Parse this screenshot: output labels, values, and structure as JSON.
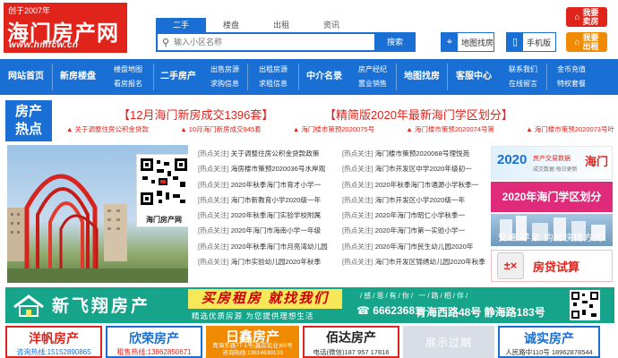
{
  "logo": {
    "since": "创于2007年",
    "name": "海门房产网",
    "url": "www.hmfcw.cn"
  },
  "search": {
    "tabs": [
      "二手",
      "楼盘",
      "出租",
      "资讯"
    ],
    "active_tab": "二手",
    "placeholder": "输入小区名称",
    "button": "搜索"
  },
  "header_buttons": {
    "map": "地图找房",
    "phone": "手机版",
    "sell_line1": "我要",
    "sell_line2": "卖房",
    "rent_line1": "我要",
    "rent_line2": "出租"
  },
  "nav": {
    "home": "网站首页",
    "new_homes": "新房楼盘",
    "new_sub_1": "楼盘地图",
    "new_sub_2": "看房报名",
    "second_hand": "二手房产",
    "sh_sub_1": "出售房源",
    "sh_sub_2": "求购信息",
    "rent_sub_1": "出租房源",
    "rent_sub_2": "求租信息",
    "agency": "中介名录",
    "agency_sub_1": "房产经纪",
    "agency_sub_2": "置业销售",
    "map_search": "地图找房",
    "customer": "客服中心",
    "cs_sub_1": "联系我们",
    "cs_sub_2": "在线留言",
    "vip_sub_1": "金币充值",
    "vip_sub_2": "特权套餐"
  },
  "hot": {
    "label_1": "房产",
    "label_2": "热点",
    "headline_1": "【12月海门新房成交1396套】",
    "headline_2": "【精简版2020年最新海门学区划分】",
    "sublinks": [
      "▲ 关于调整住房公积金贷款",
      "▲ 10月海门新房成交945套",
      "▲ 海门楼市第预2020075号",
      "▲ 海门楼市策预2020074号第",
      "▲ 海门楼市策预2020073号叶"
    ]
  },
  "photo": {
    "qr_caption": "海门房产网"
  },
  "hot_links": {
    "tag": "[热点关注]",
    "rows": [
      [
        "关于调整住房公积金贷款政策",
        "海门楼市策预2020068号理悦苑"
      ],
      [
        "海房楼市策预2020036号水岸观",
        "海门市开发区中学2020年级初一"
      ],
      [
        "2020年秋季海门市育才小学一",
        "2020年秋季海门市通源小学秋季一"
      ],
      [
        "海门市新教育小学2020级一年",
        "海门市开发区小学2020级一年"
      ],
      [
        "2020年秋季海门实验学校附属",
        "2020年海门市昭仁小学秋季一"
      ],
      [
        "2020年海门市海南小学一年级",
        "2020年海门市第一实验小学一"
      ],
      [
        "2020年秋季海门市月亮湾幼儿园",
        "2020年海门市民生幼儿园2020年"
      ],
      [
        "海门市实验幼儿园2020年秋季",
        "海门市开发区锦绣幼儿园2020年秋季"
      ]
    ]
  },
  "right_banners": {
    "year": "2020",
    "deal_text": "房产交易数据",
    "deal_sub": "成交数据 每日更新",
    "city": "海门",
    "district": "2020年海门学区划分",
    "estate": "安峰 苹果 购房快捷方式",
    "loan_icon": "±×",
    "loan": "房贷试算"
  },
  "big_banner": {
    "name": "新飞翔房产",
    "slogan": "买房租房 就找我们",
    "sub": "精选优质房源  为您提供理想生活",
    "motto": "/感/恩/有/你/  一/路/相/伴/",
    "phone": "☎ 66623681",
    "addr": "青海西路48号 静海路183号"
  },
  "ads": [
    {
      "name": "洋帆房产",
      "info": "咨询热线:15152890865"
    },
    {
      "name": "欣荣房产",
      "info": "租售热线:13862850671"
    },
    {
      "name": "日鑫房产",
      "info_1": "青海东路77-1号(鑫房宏业)60号",
      "info_2": "咨询热线:13814639133"
    },
    {
      "name": "佰达房产",
      "info": "电话(微信)187 957 17816"
    },
    {
      "name": "展示过期",
      "info": ""
    },
    {
      "name": "诚实房产",
      "info": "人民路中110号 18962878544"
    }
  ],
  "colors": {
    "brand_red": "#e0241b",
    "brand_blue": "#1a6fd4",
    "banner_green": "#16a48a",
    "district_pink": "#e02a7a",
    "accent_orange": "#f08a00"
  },
  "icons": {
    "search": "search-icon",
    "map": "location-pin-icon",
    "phone": "mobile-phone-icon",
    "sell": "sell-house-icon",
    "rent": "rent-house-icon"
  }
}
